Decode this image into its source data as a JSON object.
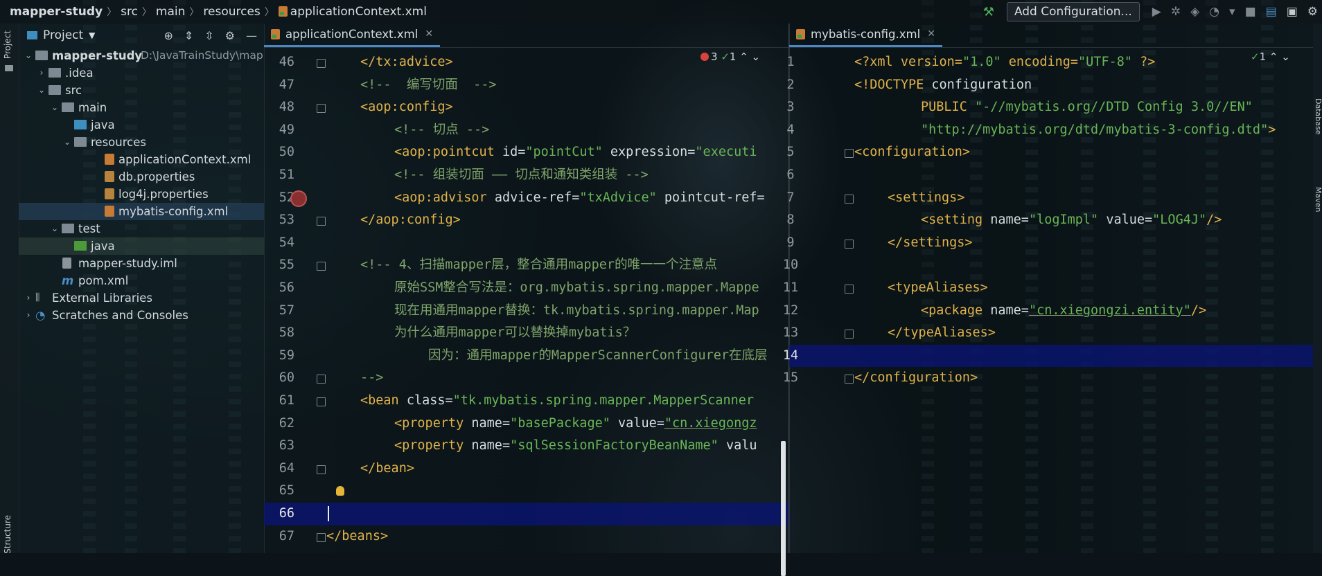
{
  "breadcrumb": {
    "project": "mapper-study",
    "items": [
      "src",
      "main",
      "resources"
    ],
    "file": "applicationContext.xml"
  },
  "toolbar": {
    "add_configuration": "Add Configuration..."
  },
  "side_stripe": {
    "project_label": "Project",
    "structure_label": "Structure"
  },
  "right_stripe": {
    "labels": [
      "Database",
      "Maven"
    ]
  },
  "project_panel": {
    "title": "Project",
    "tree": [
      {
        "label": "mapper-study",
        "path": "D:\\JavaTrainStudy\\map"
      },
      {
        "label": ".idea"
      },
      {
        "label": "src"
      },
      {
        "label": "main"
      },
      {
        "label": "java"
      },
      {
        "label": "resources"
      },
      {
        "label": "applicationContext.xml"
      },
      {
        "label": "db.properties"
      },
      {
        "label": "log4j.properties"
      },
      {
        "label": "mybatis-config.xml"
      },
      {
        "label": "test"
      },
      {
        "label": "java"
      },
      {
        "label": "mapper-study.iml"
      },
      {
        "label": "pom.xml"
      },
      {
        "label": "External Libraries"
      },
      {
        "label": "Scratches and Consoles"
      }
    ]
  },
  "left_editor": {
    "tab": "applicationContext.xml",
    "errors": "3",
    "warnings": "1",
    "lines": [
      {
        "n": "46",
        "code": [
          "</",
          "tx",
          ":advice>"
        ]
      },
      {
        "n": "47",
        "comment": "<!--  编写切面  -->"
      },
      {
        "n": "48",
        "code": [
          "<",
          "aop",
          ":config>"
        ]
      },
      {
        "n": "49",
        "comment": "<!-- 切点 -->"
      },
      {
        "n": "50",
        "a": "<",
        "ns": "aop",
        "b": ":pointcut ",
        "attr1": "id=",
        "val1": "\"pointCut\"",
        "attr2": " expression=",
        "val2": "\"executi"
      },
      {
        "n": "51",
        "comment": "<!-- 组装切面 —— 切点和通知类组装 -->"
      },
      {
        "n": "52",
        "a": "<",
        "ns": "aop",
        "b": ":advisor ",
        "attr1": "advice-ref=",
        "val1": "\"txAdvice\"",
        "attr2": " pointcut-ref=",
        "val2": ""
      },
      {
        "n": "53",
        "code": [
          "</",
          "aop",
          ":config>"
        ]
      },
      {
        "n": "54"
      },
      {
        "n": "55",
        "comment": "<!-- 4、扫描mapper层，整合通用mapper的唯一一个注意点"
      },
      {
        "n": "56",
        "comment": "原始SSM整合写法是：org.mybatis.spring.mapper.Mappe"
      },
      {
        "n": "57",
        "comment": "现在用通用mapper替换：tk.mybatis.spring.mapper.Map"
      },
      {
        "n": "58",
        "comment": "为什么通用mapper可以替换掉mybatis？"
      },
      {
        "n": "59",
        "comment": "因为：通用mapper的MapperScannerConfigurer在底层"
      },
      {
        "n": "60",
        "comment": "-->"
      },
      {
        "n": "61",
        "a": "<",
        "ns": "bean",
        "b": " ",
        "attr1": "class=",
        "val1": "\"tk.mybatis.spring.mapper.MapperScanner",
        "attr2": "",
        "val2": ""
      },
      {
        "n": "62",
        "a": "<",
        "ns": "property",
        "b": " ",
        "attr1": "name=",
        "val1": "\"basePackage\"",
        "attr2": " value=",
        "val2": "\"cn.xiegongz"
      },
      {
        "n": "63",
        "a": "<",
        "ns": "property",
        "b": " ",
        "attr1": "name=",
        "val1": "\"sqlSessionFactoryBeanName\"",
        "attr2": " valu",
        "val2": ""
      },
      {
        "n": "64",
        "code": [
          "</",
          "bean",
          ">"
        ]
      },
      {
        "n": "65"
      },
      {
        "n": "66"
      },
      {
        "n": "67",
        "code": [
          "</",
          "beans",
          ">"
        ]
      }
    ]
  },
  "right_editor": {
    "tab": "mybatis-config.xml",
    "warnings": "1",
    "lines": [
      {
        "n": "1",
        "pi": "<?xml version=",
        "v1": "\"1.0\"",
        "pi2": " encoding=",
        "v2": "\"UTF-8\"",
        "pi3": " ?>"
      },
      {
        "n": "2",
        "dt": "<!DOCTYPE",
        "rest": " configuration"
      },
      {
        "n": "3",
        "dt": "PUBLIC",
        "v1": " \"-//mybatis.org//DTD Config 3.0//EN\""
      },
      {
        "n": "4",
        "v1": "\"http://mybatis.org/dtd/mybatis-3-config.dtd\"",
        "dt2": ">"
      },
      {
        "n": "5",
        "tag": "<configuration>"
      },
      {
        "n": "6"
      },
      {
        "n": "7",
        "tag": "<settings>"
      },
      {
        "n": "8",
        "tag": "<setting",
        "attr1": " name=",
        "val1": "\"logImpl\"",
        "attr2": " value=",
        "val2": "\"LOG4J\"",
        "end": "/>"
      },
      {
        "n": "9",
        "tag": "</settings>"
      },
      {
        "n": "10"
      },
      {
        "n": "11",
        "tag": "<typeAliases>"
      },
      {
        "n": "12",
        "tag": "<package",
        "attr1": " name=",
        "val1": "\"cn.xiegongzi.entity\"",
        "end": "/>"
      },
      {
        "n": "13",
        "tag": "</typeAliases>"
      },
      {
        "n": "14"
      },
      {
        "n": "15",
        "tag": "</configuration>"
      }
    ]
  }
}
